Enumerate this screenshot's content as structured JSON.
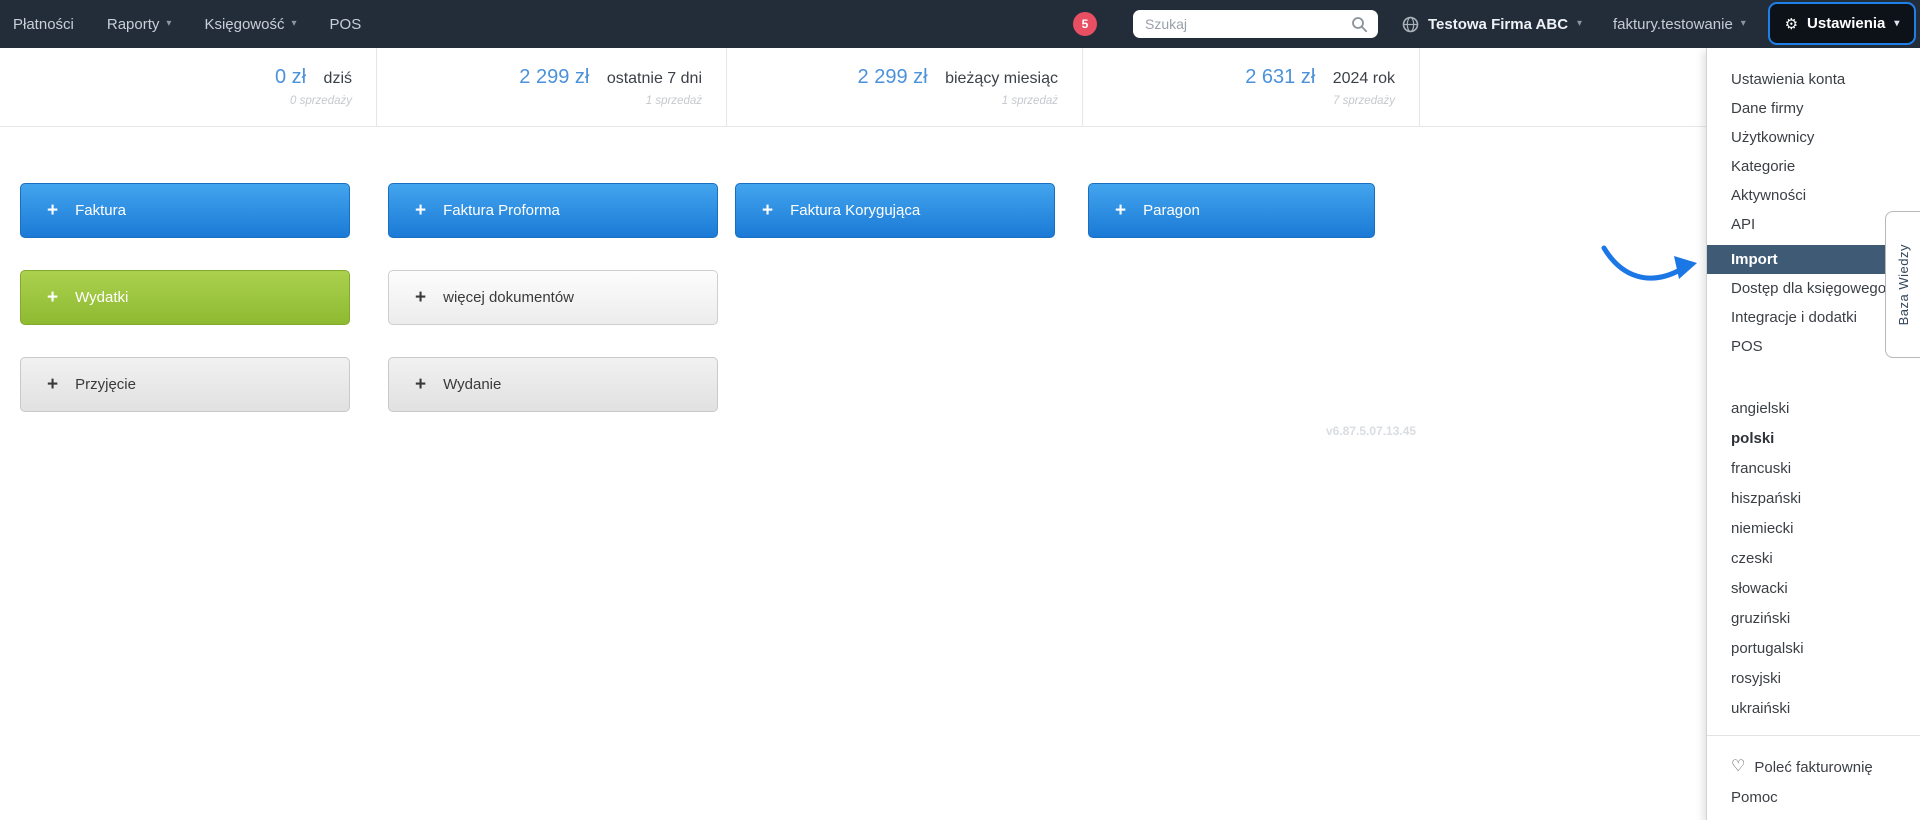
{
  "navbar": {
    "items": [
      {
        "label": "Płatności",
        "caret": false
      },
      {
        "label": "Raporty",
        "caret": true
      },
      {
        "label": "Księgowość",
        "caret": true
      },
      {
        "label": "POS",
        "caret": false
      }
    ],
    "notification_count": "5",
    "search_placeholder": "Szukaj",
    "company": "Testowa Firma ABC",
    "account": "faktury.testowanie",
    "settings_label": "Ustawienia"
  },
  "stats": [
    {
      "value": "0 zł",
      "label": "dziś",
      "sub": "0 sprzedaży"
    },
    {
      "value": "2 299 zł",
      "label": "ostatnie 7 dni",
      "sub": "1 sprzedaż"
    },
    {
      "value": "2 299 zł",
      "label": "bieżący miesiąc",
      "sub": "1 sprzedaż"
    },
    {
      "value": "2 631 zł",
      "label": "2024 rok",
      "sub": "7 sprzedaży"
    }
  ],
  "actions": {
    "row1": [
      "Faktura",
      "Faktura Proforma",
      "Faktura Korygująca",
      "Paragon"
    ],
    "row2": [
      "Wydatki",
      "więcej dokumentów"
    ],
    "row3": [
      "Przyjęcie",
      "Wydanie"
    ]
  },
  "version": "v6.87.5.07.13.45",
  "settings_menu": {
    "items": [
      "Ustawienia konta",
      "Dane firmy",
      "Użytkownicy",
      "Kategorie",
      "Aktywności",
      "API",
      "Import",
      "Dostęp dla księgowego",
      "Integracje i dodatki",
      "POS"
    ],
    "active_item": "Import",
    "languages": [
      "angielski",
      "polski",
      "francuski",
      "hiszpański",
      "niemiecki",
      "czeski",
      "słowacki",
      "gruziński",
      "portugalski",
      "rosyjski",
      "ukraiński"
    ],
    "current_language": "polski",
    "footer": [
      {
        "label": "Poleć fakturownię"
      },
      {
        "label": "Pomoc"
      }
    ]
  },
  "knowledge_tab": "Baza Wiedzy",
  "icons": {
    "caret": "▾",
    "gear": "⚙",
    "plus": "+",
    "heart": "♡"
  },
  "colors": {
    "navbar_bg": "#232d3a",
    "accent_blue": "#1e7fe8",
    "badge_red": "#e84f63",
    "stat_blue": "#4c92da",
    "active_menu_bg": "#3e5a74",
    "button_blue": "#1b7ad6",
    "button_green": "#9cc43c"
  }
}
